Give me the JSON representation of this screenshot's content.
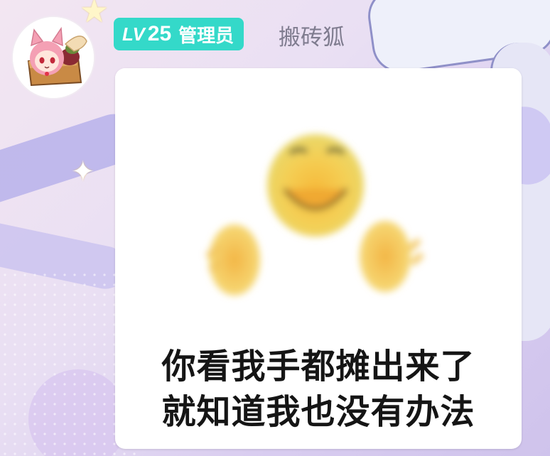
{
  "header": {
    "level_prefix": "LV",
    "level_number": "25",
    "role": "管理员",
    "username": "搬砖狐"
  },
  "message": {
    "caption_line1": "你看我手都摊出来了",
    "caption_line2": "就知道我也没有办法"
  },
  "icons": {
    "avatar": "fox-girl-avatar",
    "sticker": "shrugging-emoji"
  },
  "colors": {
    "badge_bg": "#34d9c9",
    "username_text": "#7f7c8f",
    "bubble_bg": "#ffffff"
  }
}
